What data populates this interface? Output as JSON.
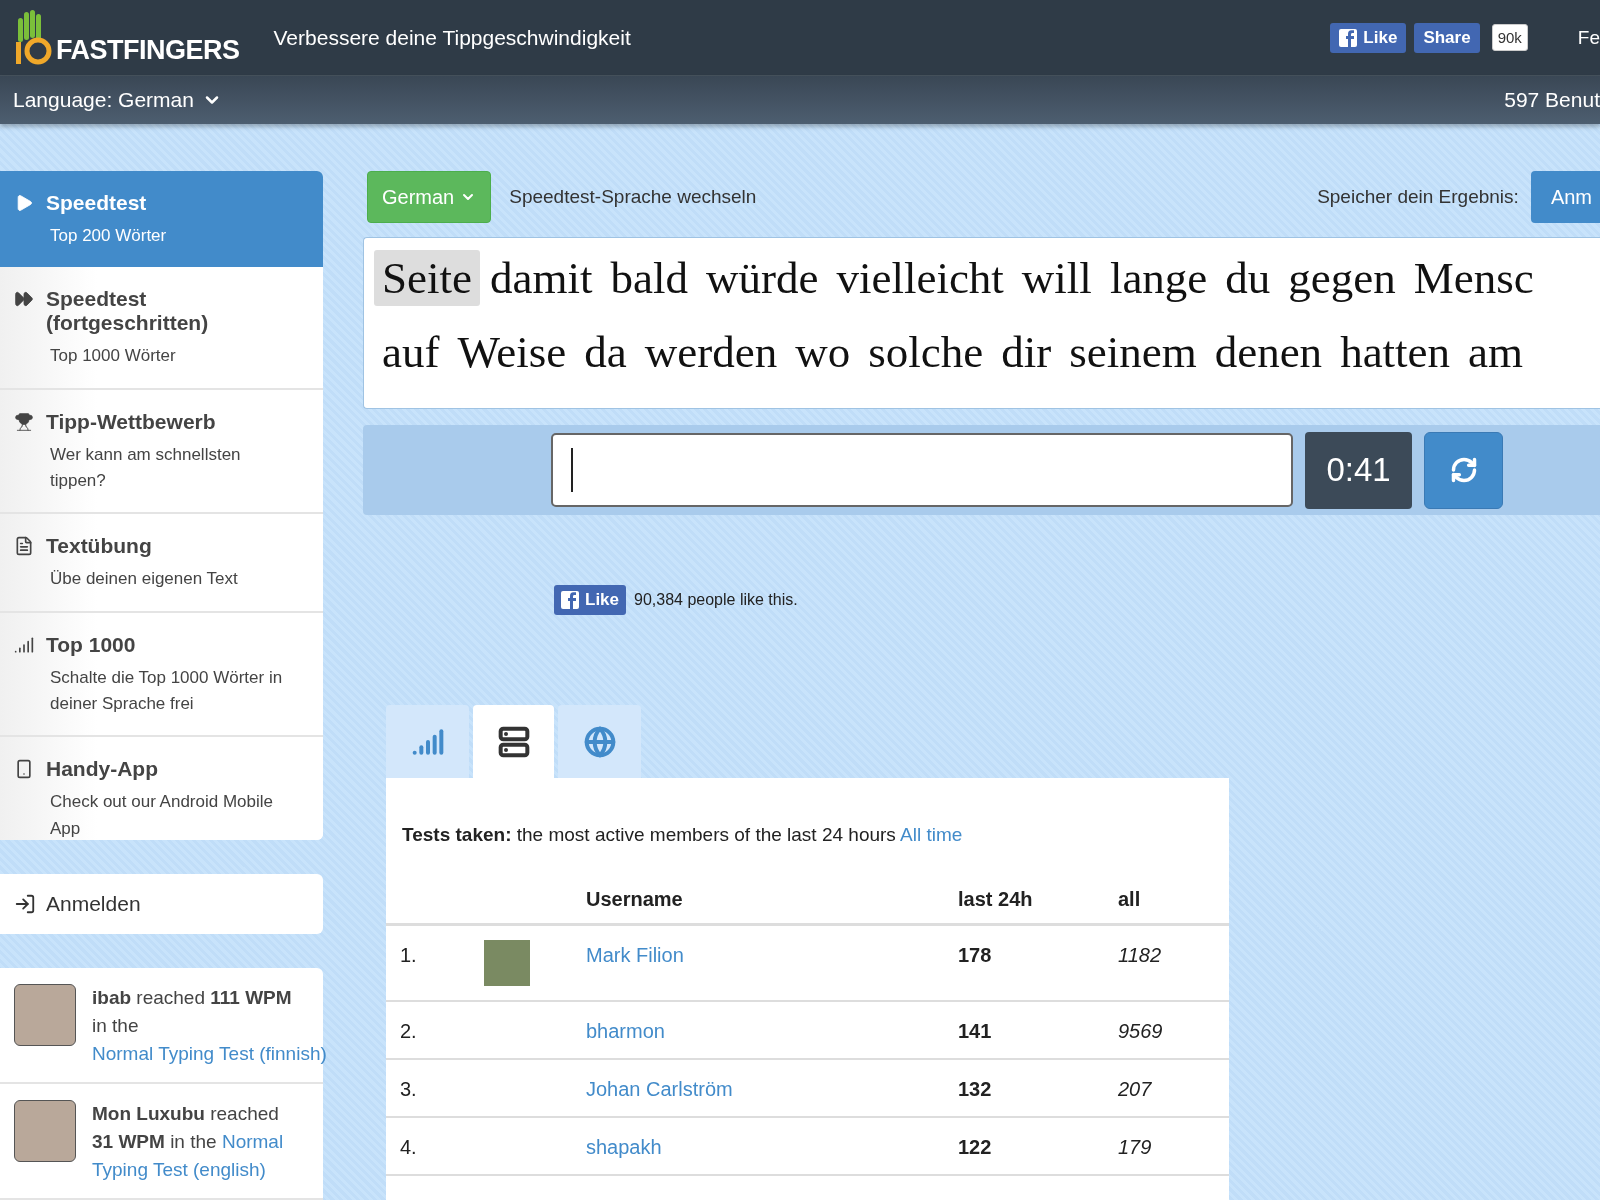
{
  "header": {
    "logo": "FASTFINGERS",
    "tagline": "Verbessere deine Tippgeschwindigkeit",
    "like_button": "Like",
    "share_button": "Share",
    "like_count": "90k",
    "cut_link": "Fe"
  },
  "subheader": {
    "language": "Language: German",
    "users_online": "597 Benut"
  },
  "sidebar": {
    "items": [
      {
        "title": "Speedtest",
        "subtitle": "Top 200 Wörter",
        "selected": true
      },
      {
        "title": "Speedtest (fortgeschritten)",
        "subtitle": "Top 1000 Wörter",
        "selected": false
      },
      {
        "title": "Tipp-Wettbewerb",
        "subtitle": "Wer kann am schnellsten tippen?",
        "selected": false
      },
      {
        "title": "Textübung",
        "subtitle": "Übe deinen eigenen Text",
        "selected": false
      },
      {
        "title": "Top 1000",
        "subtitle": "Schalte die Top 1000 Wörter in deiner Sprache frei",
        "selected": false
      },
      {
        "title": "Handy-App",
        "subtitle": "Check out our Android Mobile App",
        "selected": false
      }
    ],
    "login": "Anmelden"
  },
  "activity": [
    {
      "text": "**ibab** reached **111 WPM** in the",
      "link": "Normal Typing Test (finnish)"
    },
    {
      "text": "**Mon Luxubu** reached **31 WPM** in the",
      "link": "Typing Test (english)",
      "link_prefix": "Normal"
    }
  ],
  "toolbar": {
    "language_button": "German",
    "change_language": "Speedtest-Sprache wechseln",
    "save_label": "Speicher dein Ergebnis:",
    "save_button": "Anm"
  },
  "words": {
    "lines": [
      {
        "words": [
          {
            "text": "Seite",
            "highlighted": true
          },
          {
            "text": "damit",
            "highlighted": false
          },
          {
            "text": "bald",
            "highlighted": false
          },
          {
            "text": "würde",
            "highlighted": false
          },
          {
            "text": "vielleicht",
            "highlighted": false
          },
          {
            "text": "will",
            "highlighted": false
          },
          {
            "text": "lange",
            "highlighted": false
          },
          {
            "text": "du",
            "highlighted": false
          },
          {
            "text": "gegen",
            "highlighted": false
          },
          {
            "text": "Mensc",
            "highlighted": false
          }
        ]
      },
      {
        "words": [
          {
            "text": "auf",
            "highlighted": false
          },
          {
            "text": "Weise",
            "highlighted": false
          },
          {
            "text": "da",
            "highlighted": false
          },
          {
            "text": "werden",
            "highlighted": false
          },
          {
            "text": "wo",
            "highlighted": false
          },
          {
            "text": "solche",
            "highlighted": false
          },
          {
            "text": "dir",
            "highlighted": false
          },
          {
            "text": "seinem",
            "highlighted": false
          },
          {
            "text": "denen",
            "highlighted": false
          },
          {
            "text": "hatten",
            "highlighted": false
          },
          {
            "text": "am",
            "highlighted": false
          }
        ]
      }
    ]
  },
  "typing": {
    "timer": "0:41"
  },
  "facebook": {
    "like_button": "Like",
    "text": "90,384 people like this."
  },
  "stats_tabs": [
    {
      "selected": false
    },
    {
      "selected": true
    },
    {
      "selected": false
    }
  ],
  "leaderboard": {
    "intro": "**Tests taken:** the most active members of the last 24 hours",
    "link": "All time",
    "columns": [
      "Username",
      "last 24h",
      "all"
    ],
    "rows": [
      {
        "rank": "1.",
        "avatar": true,
        "username": "Mark Filion",
        "last_24h": "178",
        "all": "1182"
      },
      {
        "rank": "2.",
        "avatar": false,
        "username": "bharmon",
        "last_24h": "141",
        "all": "9569"
      },
      {
        "rank": "3.",
        "avatar": false,
        "username": "Johan Carlström",
        "last_24h": "132",
        "all": "207"
      },
      {
        "rank": "4.",
        "avatar": false,
        "username": "shapakh",
        "last_24h": "122",
        "all": "179"
      }
    ]
  }
}
